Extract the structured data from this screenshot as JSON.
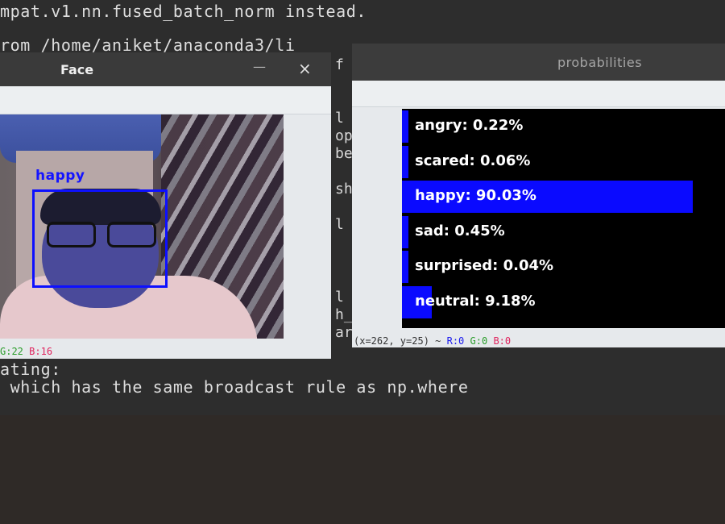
{
  "terminal": {
    "line1": "mpat.v1.nn.fused_batch_norm instead.",
    "line2": "rom /home/aniket/anaconda3/li",
    "line3": "ating:",
    "line4": " which has the same broadcast rule as np.where",
    "frag_f": "f",
    "frag_a": "l\nop\nbe\n\nsh\n\nl",
    "frag_b": "l\nh_\nar"
  },
  "face_window": {
    "title": "Face",
    "minimize_icon": "minimize-icon",
    "close_symbol": "×",
    "detected_label": "happy",
    "status_g": "G:22",
    "status_b": "B:16"
  },
  "prob_window": {
    "title": "probabilities",
    "rows": [
      {
        "label": "angry: 0.22%",
        "value": 0.22
      },
      {
        "label": "scared: 0.06%",
        "value": 0.06
      },
      {
        "label": "happy: 90.03%",
        "value": 90.03
      },
      {
        "label": "sad: 0.45%",
        "value": 0.45
      },
      {
        "label": "surprised: 0.04%",
        "value": 0.04
      },
      {
        "label": "neutral: 9.18%",
        "value": 9.18
      }
    ],
    "status_coords": "(x=262, y=25) ~",
    "status_r": "R:0",
    "status_g": "G:0",
    "status_b": "B:0"
  },
  "colors": {
    "bar": "#0a0aff",
    "status_g": "#2a9d2a",
    "status_b": "#e0245e",
    "status_r": "#1a1aee"
  }
}
